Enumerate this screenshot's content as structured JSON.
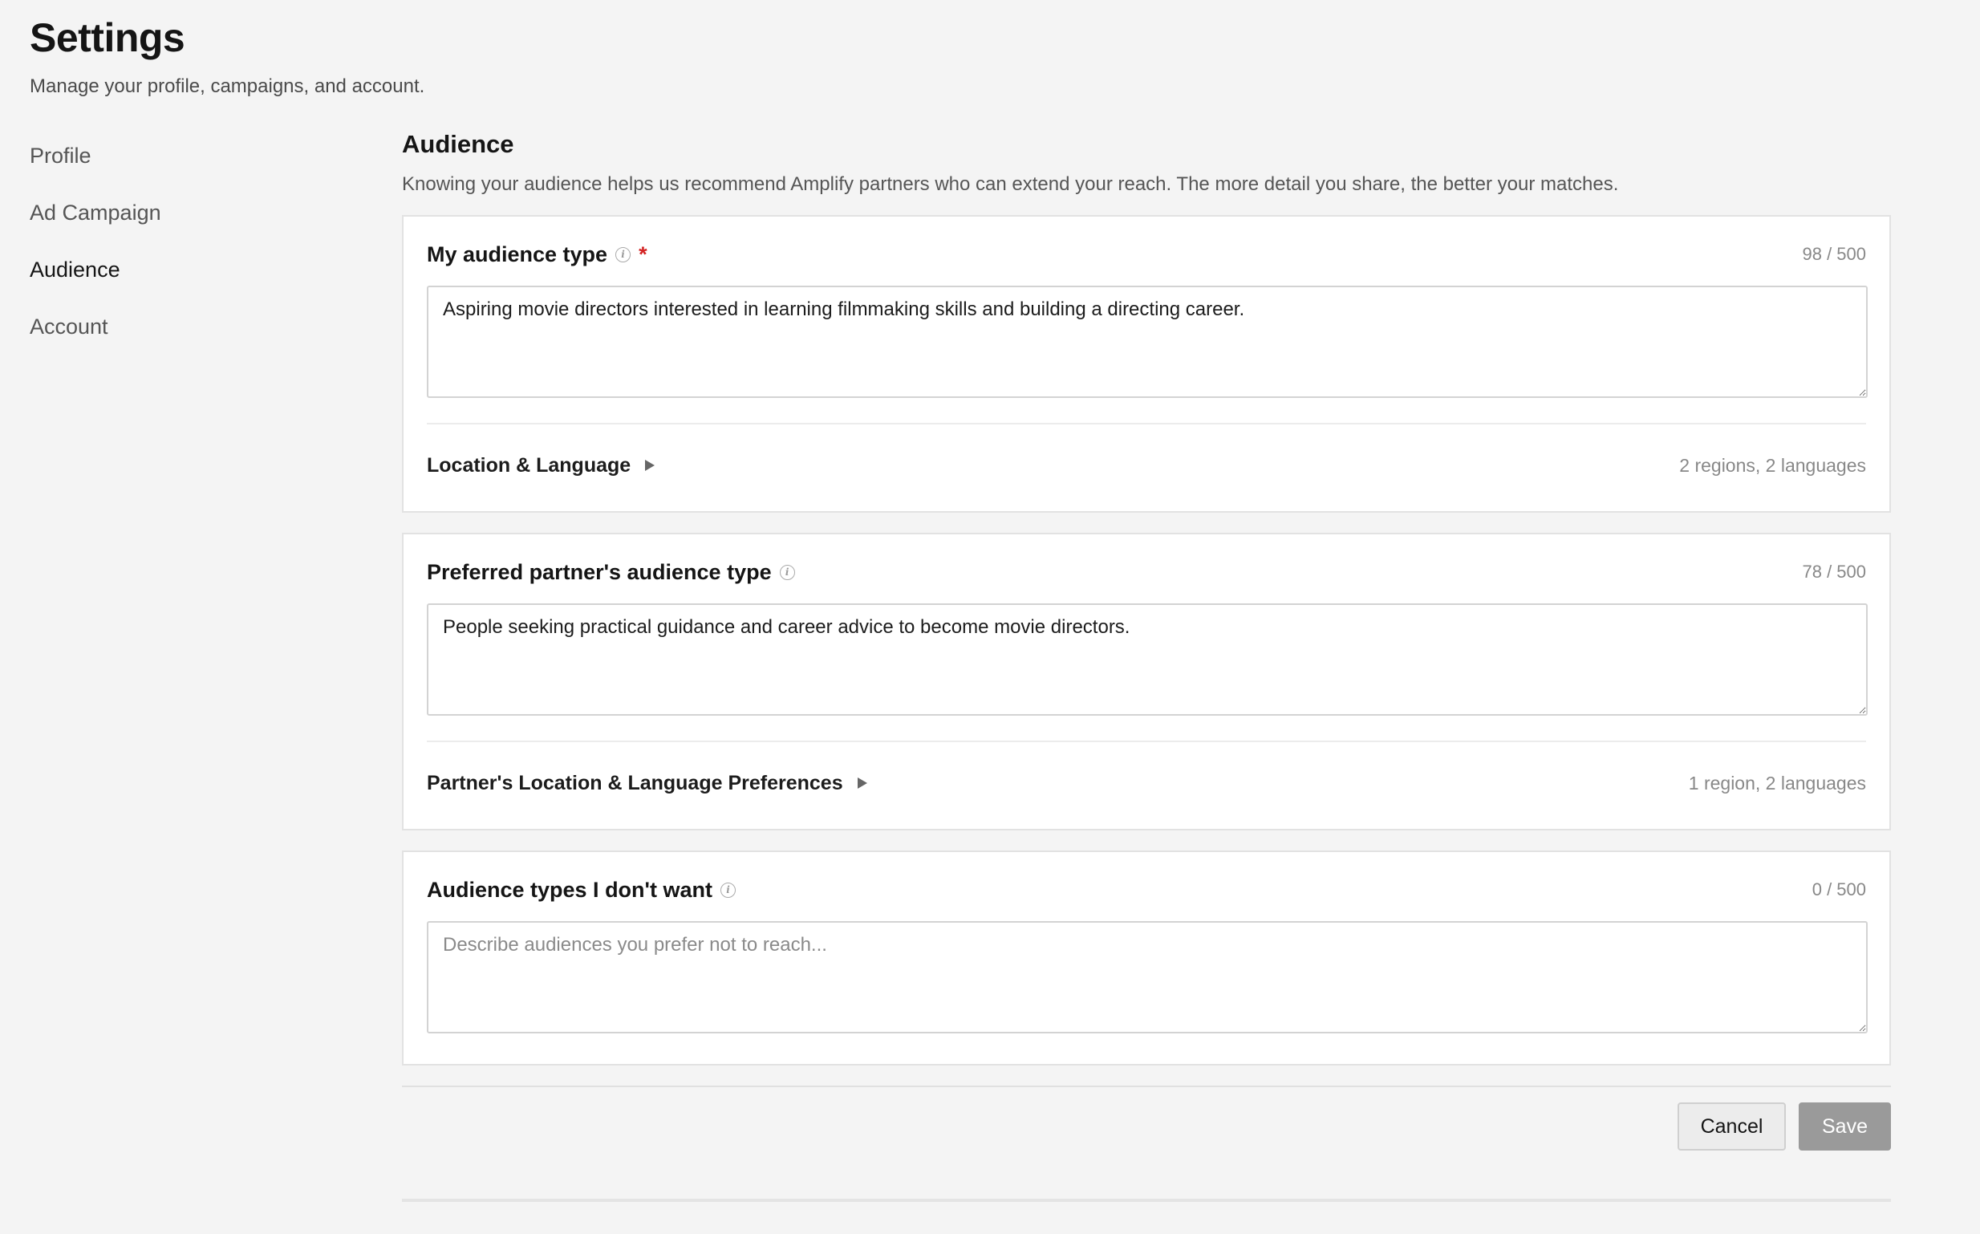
{
  "header": {
    "title": "Settings",
    "subtitle": "Manage your profile, campaigns, and account."
  },
  "sidebar": {
    "items": [
      {
        "label": "Profile"
      },
      {
        "label": "Ad Campaign"
      },
      {
        "label": "Audience",
        "active": true
      },
      {
        "label": "Account"
      }
    ]
  },
  "main": {
    "title": "Audience",
    "description": "Knowing your audience helps us recommend Amplify partners who can extend your reach. The more detail you share, the better your matches."
  },
  "my_audience": {
    "label": "My audience type",
    "required_mark": "*",
    "counter": "98 / 500",
    "value": "Aspiring movie directors interested in learning filmmaking skills and building a directing career.",
    "expand_label": "Location & Language",
    "expand_summary": "2 regions, 2 languages"
  },
  "partner_audience": {
    "label": "Preferred partner's audience type",
    "counter": "78 / 500",
    "value": "People seeking practical guidance and career advice to become movie directors.",
    "expand_label": "Partner's Location & Language Preferences",
    "expand_summary": "1 region, 2 languages"
  },
  "excluded_audience": {
    "label": "Audience types I don't want",
    "counter": "0 / 500",
    "value": "",
    "placeholder": "Describe audiences you prefer not to reach..."
  },
  "actions": {
    "cancel_label": "Cancel",
    "save_label": "Save"
  },
  "icons": {
    "info": "info-icon",
    "expand": "caret-right-icon"
  },
  "colors": {
    "required": "#d32222",
    "save_disabled": "#9a9a9a"
  }
}
